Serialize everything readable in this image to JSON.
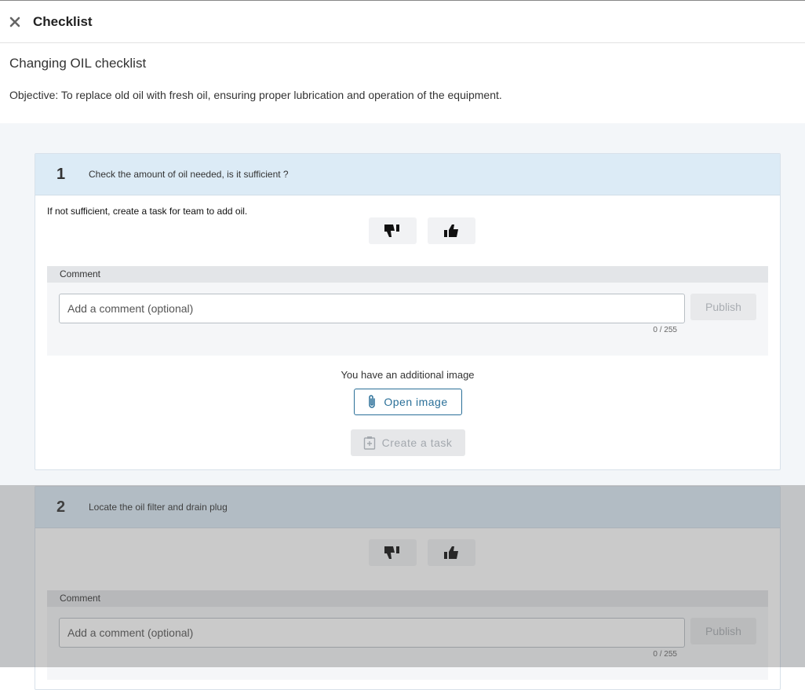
{
  "header": {
    "title": "Checklist"
  },
  "checklist": {
    "name": "Changing OIL checklist",
    "objective": "Objective: To replace old oil with fresh oil, ensuring proper lubrication and operation of the equipment."
  },
  "steps": [
    {
      "number": "1",
      "title": "Check the amount of oil needed, is it sufficient ?",
      "description": "If not sufficient, create a task for team to add oil.",
      "comment_label": "Comment",
      "comment_placeholder": "Add a comment (optional)",
      "publish_label": "Publish",
      "char_count": "0 / 255",
      "image_note": "You have an additional image",
      "open_image_label": "Open image",
      "create_task_label": "Create a task"
    },
    {
      "number": "2",
      "title": "Locate the oil filter and drain plug",
      "comment_label": "Comment",
      "comment_placeholder": "Add a comment (optional)",
      "publish_label": "Publish",
      "char_count": "0 / 255"
    }
  ],
  "icons": {
    "close": "close-icon",
    "thumbs_down": "thumbs-down-icon",
    "thumbs_up": "thumbs-up-icon",
    "paperclip": "paperclip-icon",
    "task": "task-icon"
  },
  "colors": {
    "accent": "#2a6f98",
    "step_header": "#dcebf6",
    "background": "#f3f6f9"
  }
}
